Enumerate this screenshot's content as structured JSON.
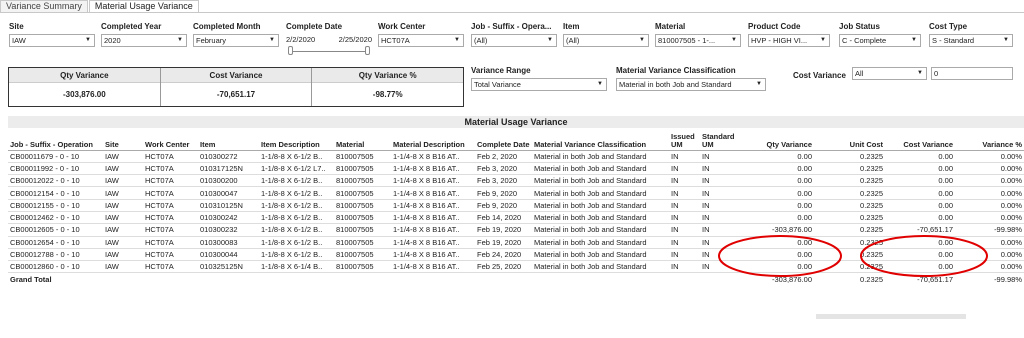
{
  "tabs": [
    "Variance Summary",
    "Material Usage Variance"
  ],
  "filters": {
    "site": {
      "label": "Site",
      "value": "IAW"
    },
    "completed_year": {
      "label": "Completed Year",
      "value": "2020"
    },
    "completed_month": {
      "label": "Completed Month",
      "value": "February"
    },
    "complete_date": {
      "label": "Complete Date",
      "from": "2/2/2020",
      "to": "2/25/2020"
    },
    "work_center": {
      "label": "Work Center",
      "value": "HCT07A"
    },
    "job_suffix_op": {
      "label": "Job - Suffix - Opera...",
      "value": "(All)"
    },
    "item": {
      "label": "Item",
      "value": "(All)"
    },
    "material": {
      "label": "Material",
      "value": "810007505 - 1-..."
    },
    "product_code": {
      "label": "Product Code",
      "value": "HVP - HIGH VI..."
    },
    "job_status": {
      "label": "Job Status",
      "value": "C - Complete"
    },
    "cost_type": {
      "label": "Cost Type",
      "value": "S - Standard"
    },
    "variance_range": {
      "label": "Variance Range",
      "value": "Total Variance"
    },
    "mat_var_class": {
      "label": "Material Variance Classification",
      "value": "Material in both Job and Standard"
    },
    "cost_variance": {
      "label": "Cost Variance",
      "op": "All",
      "value": "0"
    }
  },
  "kpi": {
    "qty_variance": {
      "label": "Qty Variance",
      "value": "-303,876.00"
    },
    "cost_variance": {
      "label": "Cost Variance",
      "value": "-70,651.17"
    },
    "qty_variance_pct": {
      "label": "Qty Variance %",
      "value": "-98.77%"
    }
  },
  "grid": {
    "title": "Material Usage Variance",
    "columns": [
      "Job - Suffix - Operation",
      "Site",
      "Work Center",
      "Item",
      "Item Description",
      "Material",
      "Material Description",
      "Complete Date",
      "Material Variance Classification",
      "Issued UM",
      "Standard UM",
      "Qty Variance",
      "Unit Cost",
      "Cost Variance",
      "Variance %"
    ],
    "rows": [
      [
        "CB00011679 - 0 - 10",
        "IAW",
        "HCT07A",
        "010300272",
        "1-1/8-8 X 6-1/2 B..",
        "810007505",
        "1-1/4-8 X 8 B16 AT..",
        "Feb 2, 2020",
        "Material in both Job and Standard",
        "IN",
        "IN",
        "0.00",
        "0.2325",
        "0.00",
        "0.00%"
      ],
      [
        "CB00011992 - 0 - 10",
        "IAW",
        "HCT07A",
        "010317125N",
        "1-1/8-8 X 6-1/2 L7..",
        "810007505",
        "1-1/4-8 X 8 B16 AT..",
        "Feb 3, 2020",
        "Material in both Job and Standard",
        "IN",
        "IN",
        "0.00",
        "0.2325",
        "0.00",
        "0.00%"
      ],
      [
        "CB00012022 - 0 - 10",
        "IAW",
        "HCT07A",
        "010300200",
        "1-1/8-8 X 6-1/2 B..",
        "810007505",
        "1-1/4-8 X 8 B16 AT..",
        "Feb 3, 2020",
        "Material in both Job and Standard",
        "IN",
        "IN",
        "0.00",
        "0.2325",
        "0.00",
        "0.00%"
      ],
      [
        "CB00012154 - 0 - 10",
        "IAW",
        "HCT07A",
        "010300047",
        "1-1/8-8 X 6-1/2 B..",
        "810007505",
        "1-1/4-8 X 8 B16 AT..",
        "Feb 9, 2020",
        "Material in both Job and Standard",
        "IN",
        "IN",
        "0.00",
        "0.2325",
        "0.00",
        "0.00%"
      ],
      [
        "CB00012155 - 0 - 10",
        "IAW",
        "HCT07A",
        "010310125N",
        "1-1/8-8 X 6-1/2 B..",
        "810007505",
        "1-1/4-8 X 8 B16 AT..",
        "Feb 9, 2020",
        "Material in both Job and Standard",
        "IN",
        "IN",
        "0.00",
        "0.2325",
        "0.00",
        "0.00%"
      ],
      [
        "CB00012462 - 0 - 10",
        "IAW",
        "HCT07A",
        "010300242",
        "1-1/8-8 X 6-1/2 B..",
        "810007505",
        "1-1/4-8 X 8 B16 AT..",
        "Feb 14, 2020",
        "Material in both Job and Standard",
        "IN",
        "IN",
        "0.00",
        "0.2325",
        "0.00",
        "0.00%"
      ],
      [
        "CB00012605 - 0 - 10",
        "IAW",
        "HCT07A",
        "010300232",
        "1-1/8-8 X 6-1/2 B..",
        "810007505",
        "1-1/4-8 X 8 B16 AT..",
        "Feb 19, 2020",
        "Material in both Job and Standard",
        "IN",
        "IN",
        "-303,876.00",
        "0.2325",
        "-70,651.17",
        "-99.98%"
      ],
      [
        "CB00012654 - 0 - 10",
        "IAW",
        "HCT07A",
        "010300083",
        "1-1/8-8 X 6-1/2 B..",
        "810007505",
        "1-1/4-8 X 8 B16 AT..",
        "Feb 19, 2020",
        "Material in both Job and Standard",
        "IN",
        "IN",
        "0.00",
        "0.2325",
        "0.00",
        "0.00%"
      ],
      [
        "CB00012788 - 0 - 10",
        "IAW",
        "HCT07A",
        "010300044",
        "1-1/8-8 X 6-1/2 B..",
        "810007505",
        "1-1/4-8 X 8 B16 AT..",
        "Feb 24, 2020",
        "Material in both Job and Standard",
        "IN",
        "IN",
        "0.00",
        "0.2325",
        "0.00",
        "0.00%"
      ],
      [
        "CB00012860 - 0 - 10",
        "IAW",
        "HCT07A",
        "010325125N",
        "1-1/8-8 X 6-1/4 B..",
        "810007505",
        "1-1/4-8 X 8 B16 AT..",
        "Feb 25, 2020",
        "Material in both Job and Standard",
        "IN",
        "IN",
        "0.00",
        "0.2325",
        "0.00",
        "0.00%"
      ]
    ],
    "total": {
      "label": "Grand Total",
      "qty_variance": "-303,876.00",
      "unit_cost": "0.2325",
      "cost_variance": "-70,651.17",
      "variance_pct": "-99.98%"
    }
  },
  "annotation_color": "#e00000"
}
